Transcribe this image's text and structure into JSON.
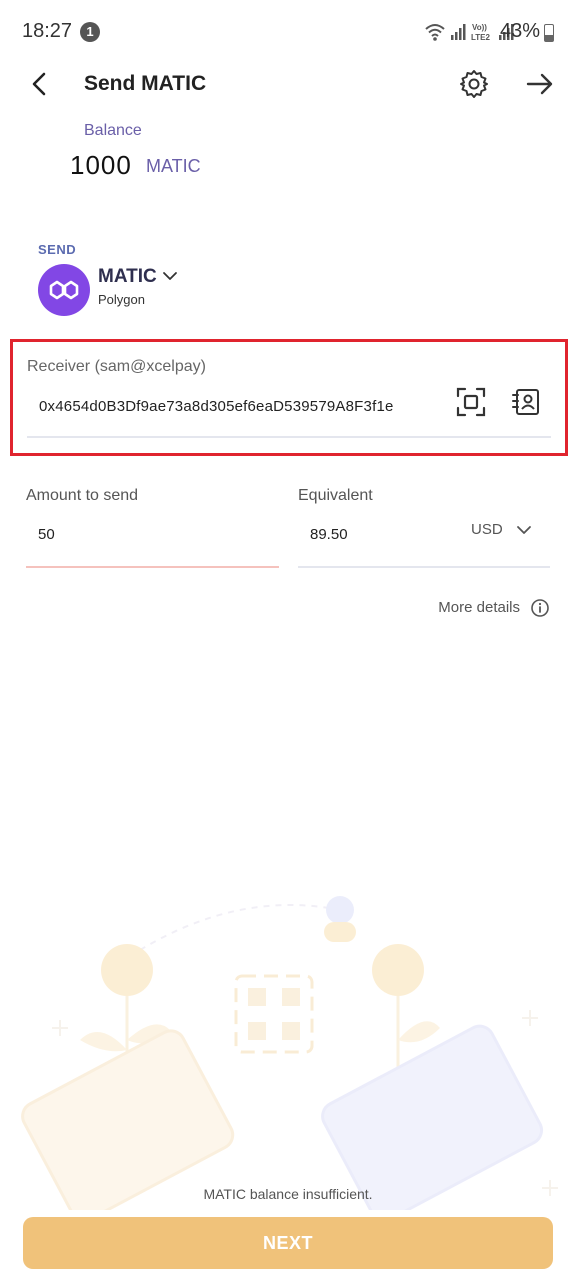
{
  "status_bar": {
    "time": "18:27",
    "notification_count": "1",
    "network_label": "Vo)) LTE2",
    "battery_percent": "43%"
  },
  "header": {
    "title": "Send MATIC",
    "icons": [
      "back-arrow-icon",
      "gear-icon",
      "forward-arrow-icon"
    ]
  },
  "balance": {
    "label": "Balance",
    "amount": "1000",
    "unit": "MATIC"
  },
  "send": {
    "label": "SEND",
    "token_symbol": "MATIC",
    "network": "Polygon",
    "token_color": "#8247e5"
  },
  "receiver": {
    "label": "Receiver (sam@xcelpay)",
    "address": "0x4654d0B3Df9ae73a8d305ef6eaD539579A8F3f1e",
    "highlight_color": "#e0242e"
  },
  "amount": {
    "label": "Amount to send",
    "value": "50"
  },
  "equivalent": {
    "label": "Equivalent",
    "value": "89.50",
    "currency": "USD"
  },
  "more_details": "More details",
  "footer": {
    "message": "MATIC balance insufficient.",
    "next_label": "NEXT",
    "next_color": "#f0c27a"
  }
}
